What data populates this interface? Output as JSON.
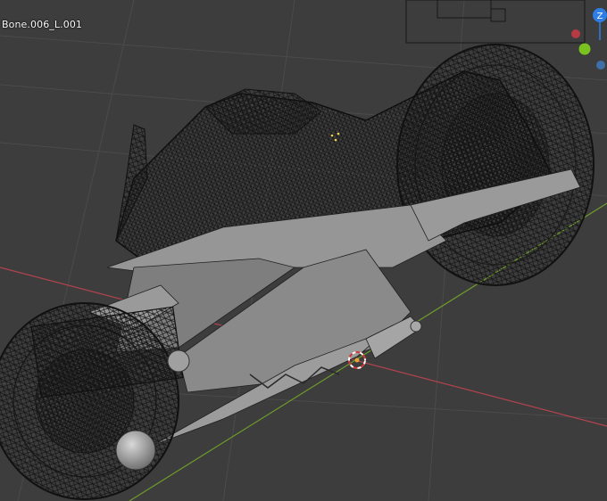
{
  "viewport": {
    "active_object_label": "Bone.006_L.001"
  },
  "nav_gizmo": {
    "axes": [
      {
        "name": "z-axis",
        "label": "Z",
        "color": "#2f7ee6"
      },
      {
        "name": "x-axis-negative",
        "label": "",
        "color": "#b83a44"
      },
      {
        "name": "y-axis-positive",
        "label": "",
        "color": "#7ac21f"
      },
      {
        "name": "y-axis-negative",
        "label": "",
        "color": "#3f6fa8"
      }
    ]
  },
  "colors": {
    "background": "#3d3d3d",
    "grid": "#4a4a4a",
    "x_axis_line": "#b3434e",
    "y_axis_line": "#6e9b2a",
    "mesh_solid": "#8c8c8c",
    "wireframe": "#141414",
    "cursor_red": "#d23b3b",
    "cursor_white": "#ffffff"
  },
  "icons": [
    "3d-cursor-icon"
  ]
}
